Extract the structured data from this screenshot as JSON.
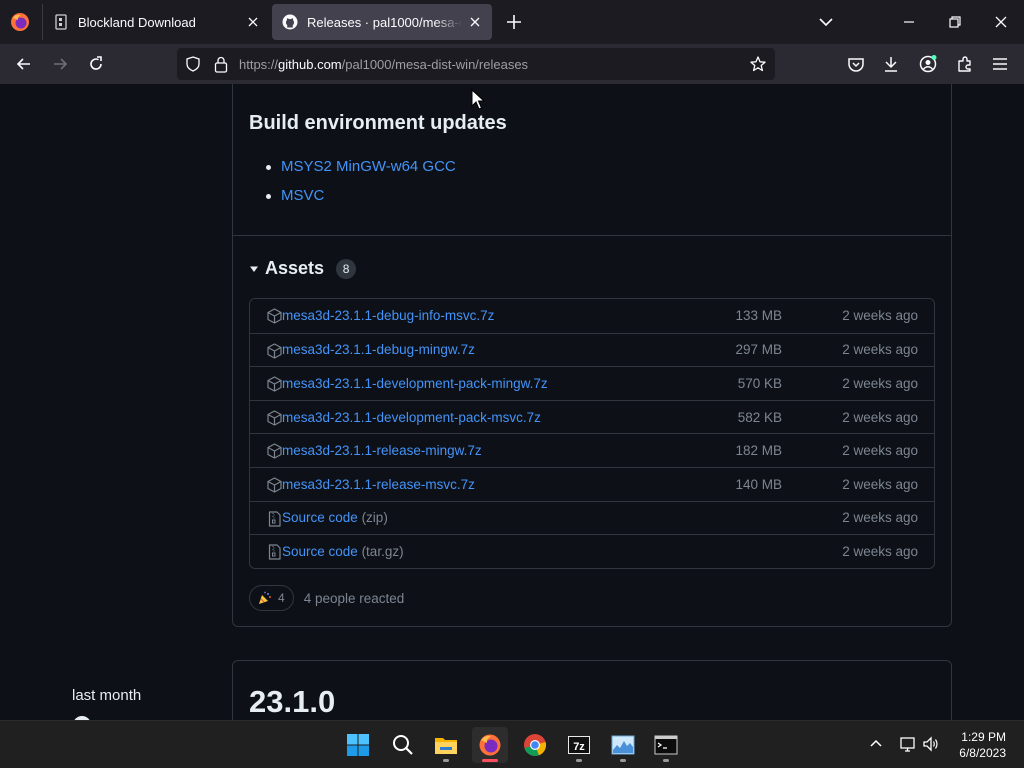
{
  "browser": {
    "tabs": [
      {
        "title": "Blockland Download",
        "active": false,
        "icon": "blockland-page-icon"
      },
      {
        "title": "Releases · pal1000/mesa-dist-win",
        "active": true,
        "icon": "github-icon"
      }
    ],
    "url": {
      "prefix": "https://",
      "host": "github.com",
      "path": "/pal1000/mesa-dist-win/releases"
    }
  },
  "page": {
    "section_title": "Build environment updates",
    "build_items": [
      "MSYS2 MinGW-w64 GCC",
      "MSVC"
    ],
    "assets": {
      "title": "Assets",
      "count": "8",
      "rows": [
        {
          "name": "mesa3d-23.1.1-debug-info-msvc.7z",
          "ext": "",
          "size": "133 MB",
          "date": "2 weeks ago",
          "icon": "package-icon"
        },
        {
          "name": "mesa3d-23.1.1-debug-mingw.7z",
          "ext": "",
          "size": "297 MB",
          "date": "2 weeks ago",
          "icon": "package-icon"
        },
        {
          "name": "mesa3d-23.1.1-development-pack-mingw.7z",
          "ext": "",
          "size": "570 KB",
          "date": "2 weeks ago",
          "icon": "package-icon"
        },
        {
          "name": "mesa3d-23.1.1-development-pack-msvc.7z",
          "ext": "",
          "size": "582 KB",
          "date": "2 weeks ago",
          "icon": "package-icon"
        },
        {
          "name": "mesa3d-23.1.1-release-mingw.7z",
          "ext": "",
          "size": "182 MB",
          "date": "2 weeks ago",
          "icon": "package-icon"
        },
        {
          "name": "mesa3d-23.1.1-release-msvc.7z",
          "ext": "",
          "size": "140 MB",
          "date": "2 weeks ago",
          "icon": "package-icon"
        },
        {
          "name": "Source code",
          "ext": " (zip)",
          "size": "",
          "date": "2 weeks ago",
          "icon": "file-zip-icon"
        },
        {
          "name": "Source code",
          "ext": " (tar.gz)",
          "size": "",
          "date": "2 weeks ago",
          "icon": "file-zip-icon"
        }
      ]
    },
    "reactions": {
      "count": "4",
      "text": "4 people reacted",
      "emoji": "tada-icon"
    },
    "next_release": {
      "version": "23.1.0",
      "date_label": "last month"
    }
  },
  "taskbar": {
    "items": [
      "start-icon",
      "search-icon",
      "file-explorer-icon",
      "firefox-icon",
      "chrome-icon",
      "7zip-icon",
      "task-manager-icon",
      "terminal-icon"
    ],
    "active": "firefox-icon",
    "time": "1:29 PM",
    "date": "6/8/2023"
  },
  "colors": {
    "link": "#4493f8",
    "muted": "#7d8590",
    "border": "#30363d",
    "page_bg": "#0d1117",
    "ff_frame": "#1c1b22",
    "ff_toolbar": "#2b2a33"
  }
}
